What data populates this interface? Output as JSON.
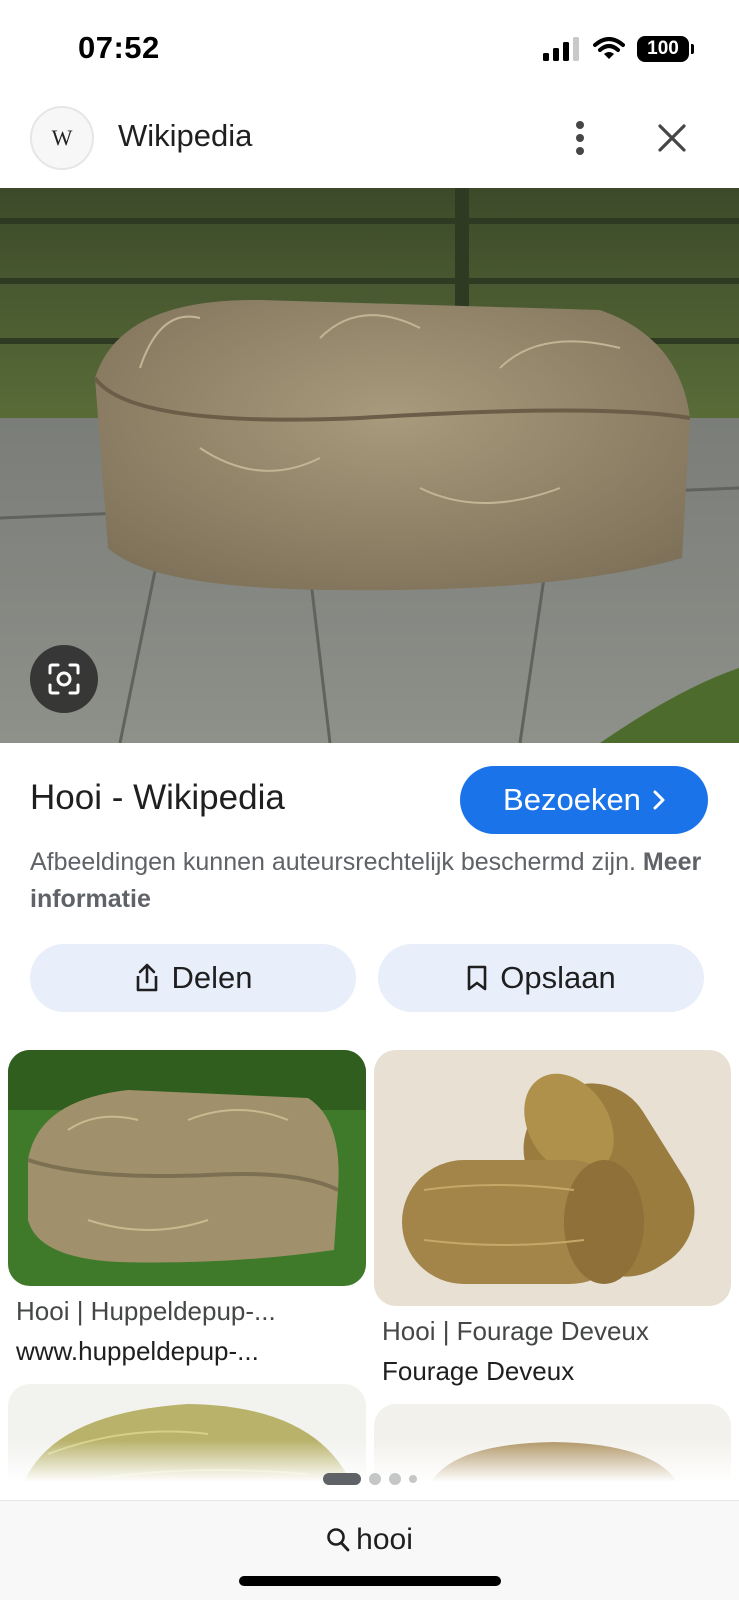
{
  "status_bar": {
    "time": "07:52",
    "battery": "100"
  },
  "header": {
    "site_name": "Wikipedia",
    "logo_letter": "W"
  },
  "result": {
    "title": "Hooi - Wikipedia",
    "visit_label": "Bezoeken",
    "copyright_text": "Afbeeldingen kunnen auteursrechtelijk beschermd zijn.",
    "more_info": "Meer informatie",
    "share_label": "Delen",
    "save_label": "Opslaan"
  },
  "related": [
    {
      "title": "Hooi | Huppeldepup-...",
      "source": "www.huppeldepup-..."
    },
    {
      "title": "Hooi | Fourage Deveux",
      "source": "Fourage Deveux"
    }
  ],
  "search": {
    "query": "hooi"
  },
  "pager": {
    "pages": 4,
    "active": 1
  },
  "icons": [
    "wikipedia-logo",
    "more-vert-icon",
    "close-icon",
    "lens-icon",
    "share-icon",
    "bookmark-icon",
    "chevron-right-icon",
    "search-icon",
    "signal-icon",
    "wifi-icon",
    "battery-icon"
  ],
  "colors": {
    "accent": "#1a73e8",
    "chip_bg": "#e8eefa",
    "secondary_text": "#5f6368"
  }
}
